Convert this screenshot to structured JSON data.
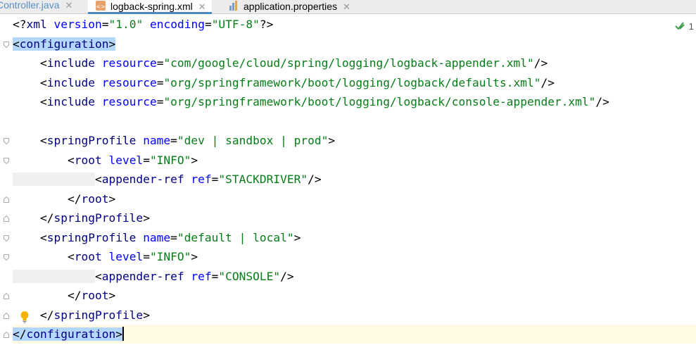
{
  "tabs": [
    {
      "label": "Controller.java",
      "active": false,
      "icon": "java-class-icon"
    },
    {
      "label": "logback-spring.xml",
      "active": true,
      "icon": "xml-file-icon"
    },
    {
      "label": "application.properties",
      "active": false,
      "icon": "properties-file-icon"
    }
  ],
  "inspection": {
    "count": "1",
    "icon": "check-icon"
  },
  "code": {
    "decl_open": "<?",
    "decl_xml": "xml",
    "decl_version_attr": "version",
    "decl_version_val": "\"1.0\"",
    "decl_encoding_attr": "encoding",
    "decl_encoding_val": "\"UTF-8\"",
    "decl_close": "?>",
    "configuration": "configuration",
    "include": "include",
    "resource_attr": "resource",
    "include1": "\"com/google/cloud/spring/logging/logback-appender.xml\"",
    "include2": "\"org/springframework/boot/logging/logback/defaults.xml\"",
    "include3": "\"org/springframework/boot/logging/logback/console-appender.xml\"",
    "springProfile": "springProfile",
    "name_attr": "name",
    "profile1": "\"dev | sandbox | prod\"",
    "profile2": "\"default | local\"",
    "root": "root",
    "level_attr": "level",
    "level_val": "\"INFO\"",
    "appender_ref": "appender-ref",
    "ref_attr": "ref",
    "ref1": "\"STACKDRIVER\"",
    "ref2": "\"CONSOLE\""
  },
  "colors": {
    "tag": "#000080",
    "attribute": "#0000ff",
    "value": "#067d17",
    "selection": "#b3d7ff",
    "caret_line": "#fffae3",
    "active_tab_underline": "#4a88c7"
  }
}
